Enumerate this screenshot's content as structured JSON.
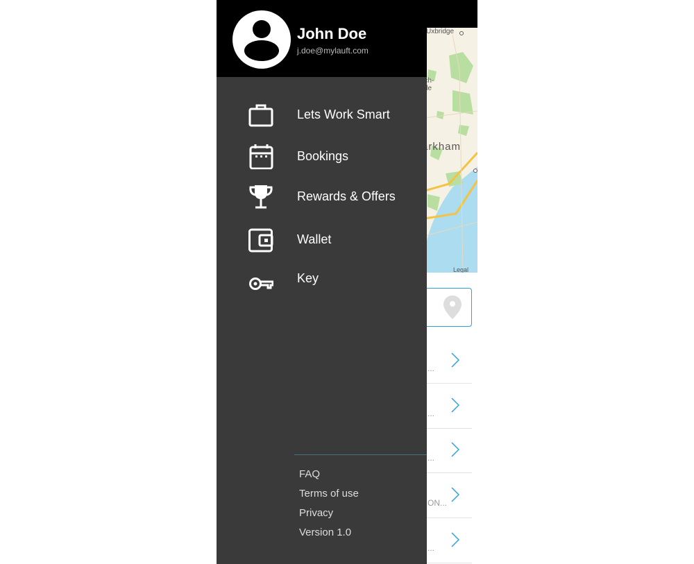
{
  "user": {
    "name": "John Doe",
    "email": "j.doe@mylauft.com"
  },
  "menu": [
    {
      "label": "Lets Work Smart",
      "icon": "briefcase-icon"
    },
    {
      "label": "Bookings",
      "icon": "calendar-icon"
    },
    {
      "label": "Rewards & Offers",
      "icon": "trophy-icon"
    },
    {
      "label": "Wallet",
      "icon": "wallet-icon"
    },
    {
      "label": "Key",
      "icon": "key-icon"
    }
  ],
  "footer": [
    {
      "label": "FAQ"
    },
    {
      "label": "Terms of use"
    },
    {
      "label": "Privacy"
    },
    {
      "label": "Version 1.0"
    }
  ],
  "map": {
    "labels": {
      "uxbridge": "Uxbridge",
      "town1": "rch-",
      "town2": "lle",
      "markham": "arkham",
      "legal": "Legal"
    }
  },
  "list": [
    {
      "snippet": "..."
    },
    {
      "snippet": "..."
    },
    {
      "snippet": "..."
    },
    {
      "snippet": "ON..."
    },
    {
      "snippet": "..."
    }
  ],
  "colors": {
    "drawer": "#3a3a3a",
    "header": "#000000",
    "accent": "#29a3dd"
  }
}
